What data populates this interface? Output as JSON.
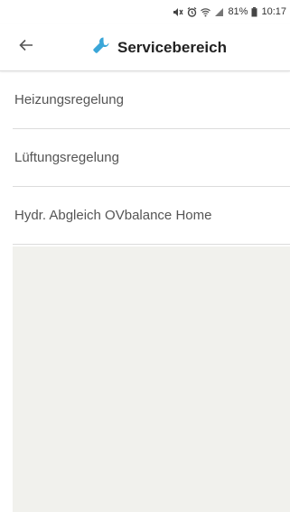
{
  "status_bar": {
    "battery": "81%",
    "time": "10:17",
    "icons": [
      "mute-icon",
      "alarm-icon",
      "wifi-icon",
      "signal-icon",
      "battery-icon"
    ]
  },
  "app_bar": {
    "back_icon": "arrow-left-icon",
    "title_icon": "wrench-icon",
    "title": "Servicebereich",
    "accent_color": "#3aa6d8"
  },
  "menu": {
    "items": [
      {
        "label": "Heizungsregelung"
      },
      {
        "label": "Lüftungsregelung"
      },
      {
        "label": "Hydr. Abgleich OVbalance Home"
      }
    ]
  }
}
